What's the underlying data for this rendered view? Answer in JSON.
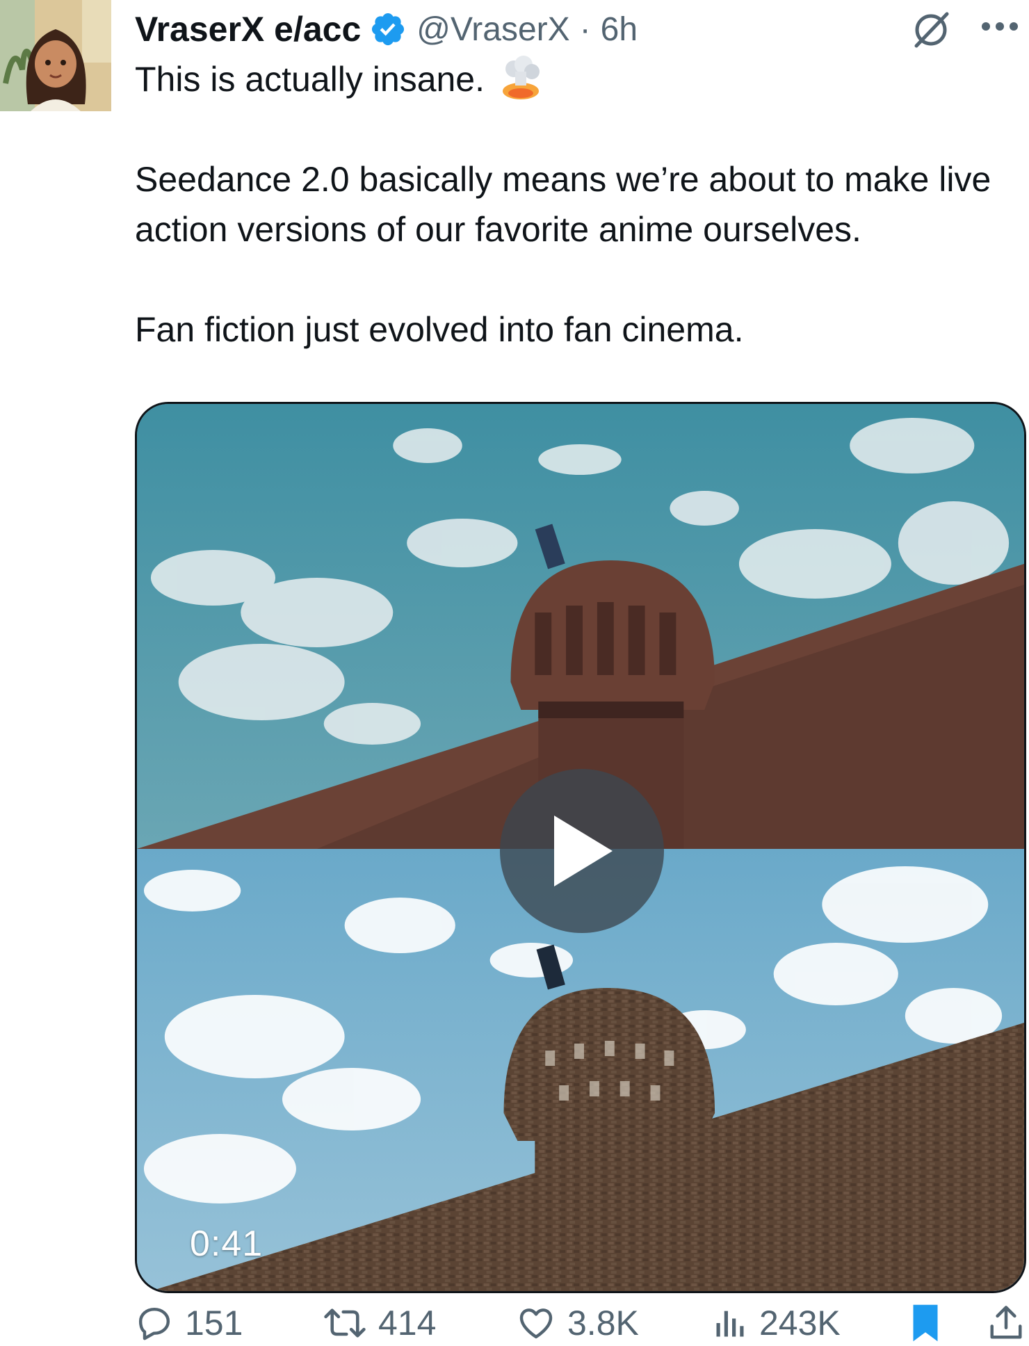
{
  "author": {
    "display_name": "VraserX e/acc",
    "handle": "@VraserX",
    "separator": "·",
    "time": "6h",
    "verified": true
  },
  "tweet": {
    "line1": "This is actually insane.",
    "line1_emoji": "exploding-head-emoji",
    "paragraph2": "Seedance 2.0 basically means we’re about to make live action versions of our favorite anime ourselves.",
    "paragraph3": "Fan fiction just evolved into fan cinema."
  },
  "media": {
    "type": "video",
    "duration": "0:41",
    "play_icon": "play-icon"
  },
  "actions": {
    "replies": {
      "icon": "reply-icon",
      "count": "151"
    },
    "reposts": {
      "icon": "repost-icon",
      "count": "414"
    },
    "likes": {
      "icon": "heart-icon",
      "count": "3.8K"
    },
    "views": {
      "icon": "views-chart-icon",
      "count": "243K"
    },
    "bookmark": {
      "icon": "bookmark-icon",
      "active": true
    },
    "share": {
      "icon": "share-icon"
    }
  },
  "colors": {
    "text_primary": "#0f1419",
    "text_secondary": "#536471",
    "verified_blue": "#1d9bf0",
    "bookmark_active": "#1d9bf0"
  }
}
